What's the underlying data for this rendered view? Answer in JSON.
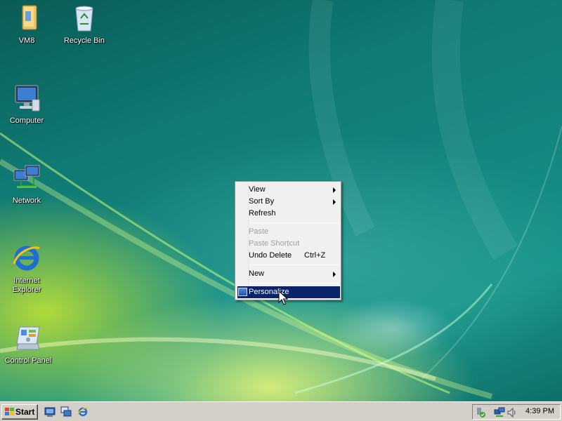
{
  "desktop": {
    "icons": [
      {
        "name": "vm8",
        "label": "VM8"
      },
      {
        "name": "recycle-bin",
        "label": "Recycle Bin"
      },
      {
        "name": "computer",
        "label": "Computer"
      },
      {
        "name": "network",
        "label": "Network"
      },
      {
        "name": "internet-explorer",
        "label": "Internet Explorer"
      },
      {
        "name": "control-panel",
        "label": "Control Panel"
      }
    ]
  },
  "context_menu": {
    "items": [
      {
        "label": "View",
        "submenu": true,
        "enabled": true
      },
      {
        "label": "Sort By",
        "submenu": true,
        "enabled": true
      },
      {
        "label": "Refresh",
        "enabled": true
      },
      {
        "label": "Paste",
        "enabled": false
      },
      {
        "label": "Paste Shortcut",
        "enabled": false
      },
      {
        "label": "Undo Delete",
        "shortcut": "Ctrl+Z",
        "enabled": true
      },
      {
        "label": "New",
        "submenu": true,
        "enabled": true
      },
      {
        "label": "Personalize",
        "enabled": true,
        "selected": true,
        "icon": "personalize-icon"
      }
    ]
  },
  "taskbar": {
    "start_label": "Start",
    "quick_launch": [
      "show-desktop-icon",
      "switch-windows-icon",
      "internet-explorer-icon"
    ],
    "tray_icons": [
      "safely-remove-icon",
      "network-icon",
      "volume-icon"
    ],
    "clock": "4:39 PM"
  },
  "colors": {
    "menu_highlight": "#0a246a",
    "menu_bg": "#f0f0f0",
    "taskbar_bg": "#d4d0c8",
    "disabled_text": "#a0a0a0"
  }
}
